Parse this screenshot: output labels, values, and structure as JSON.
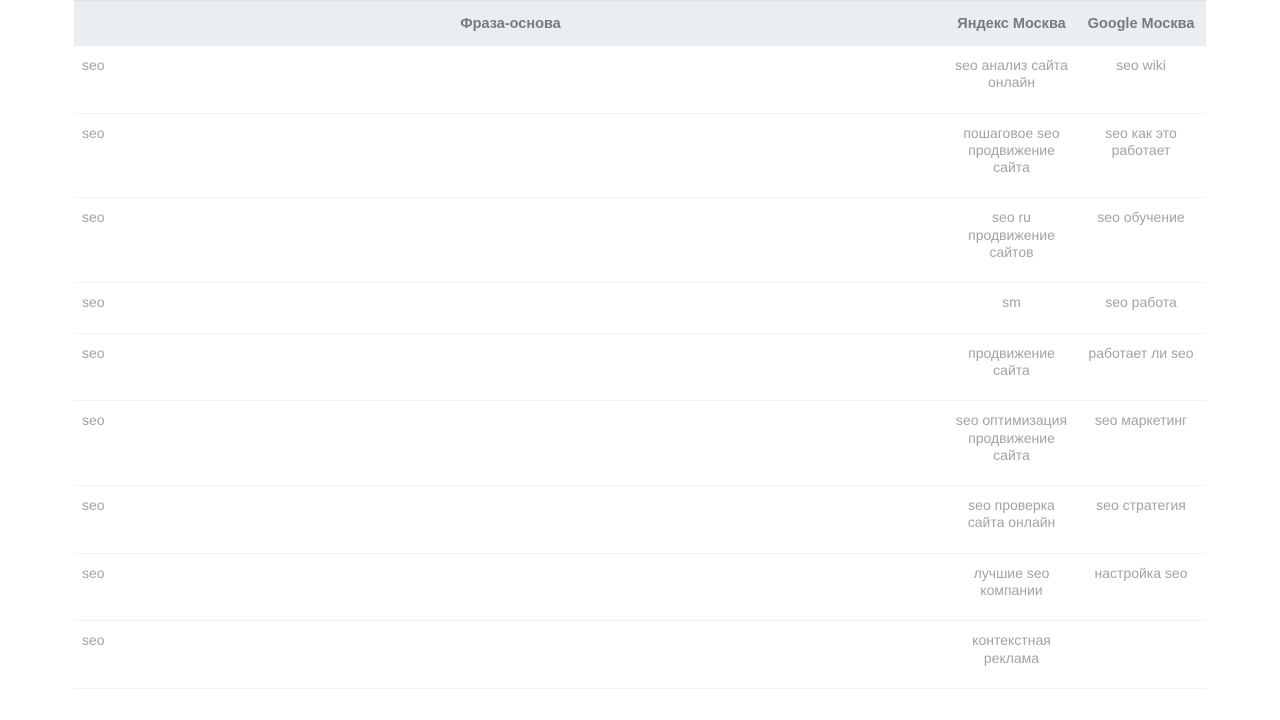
{
  "table": {
    "headers": {
      "phrase": "Фраза-основа",
      "yandex": "Яндекс Москва",
      "google": "Google Москва"
    },
    "rows": [
      {
        "phrase": "seo",
        "yandex": "seo анализ сайта онлайн",
        "google": "seo wiki"
      },
      {
        "phrase": "seo",
        "yandex": "пошаговое seo продвижение сайта",
        "google": "seo как это работает"
      },
      {
        "phrase": "seo",
        "yandex": "seo ru продвижение сайтов",
        "google": "seo обучение"
      },
      {
        "phrase": "seo",
        "yandex": "sm",
        "google": "seo работа"
      },
      {
        "phrase": "seo",
        "yandex": "продвижение сайта",
        "google": "работает ли seo"
      },
      {
        "phrase": "seo",
        "yandex": "seo оптимизация продвижение сайта",
        "google": "seo маркетинг"
      },
      {
        "phrase": "seo",
        "yandex": "seo проверка сайта онлайн",
        "google": "seo стратегия"
      },
      {
        "phrase": "seo",
        "yandex": "лучшие seo компании",
        "google": "настройка seo"
      },
      {
        "phrase": "seo",
        "yandex": "контекстная реклама",
        "google": ""
      }
    ]
  }
}
